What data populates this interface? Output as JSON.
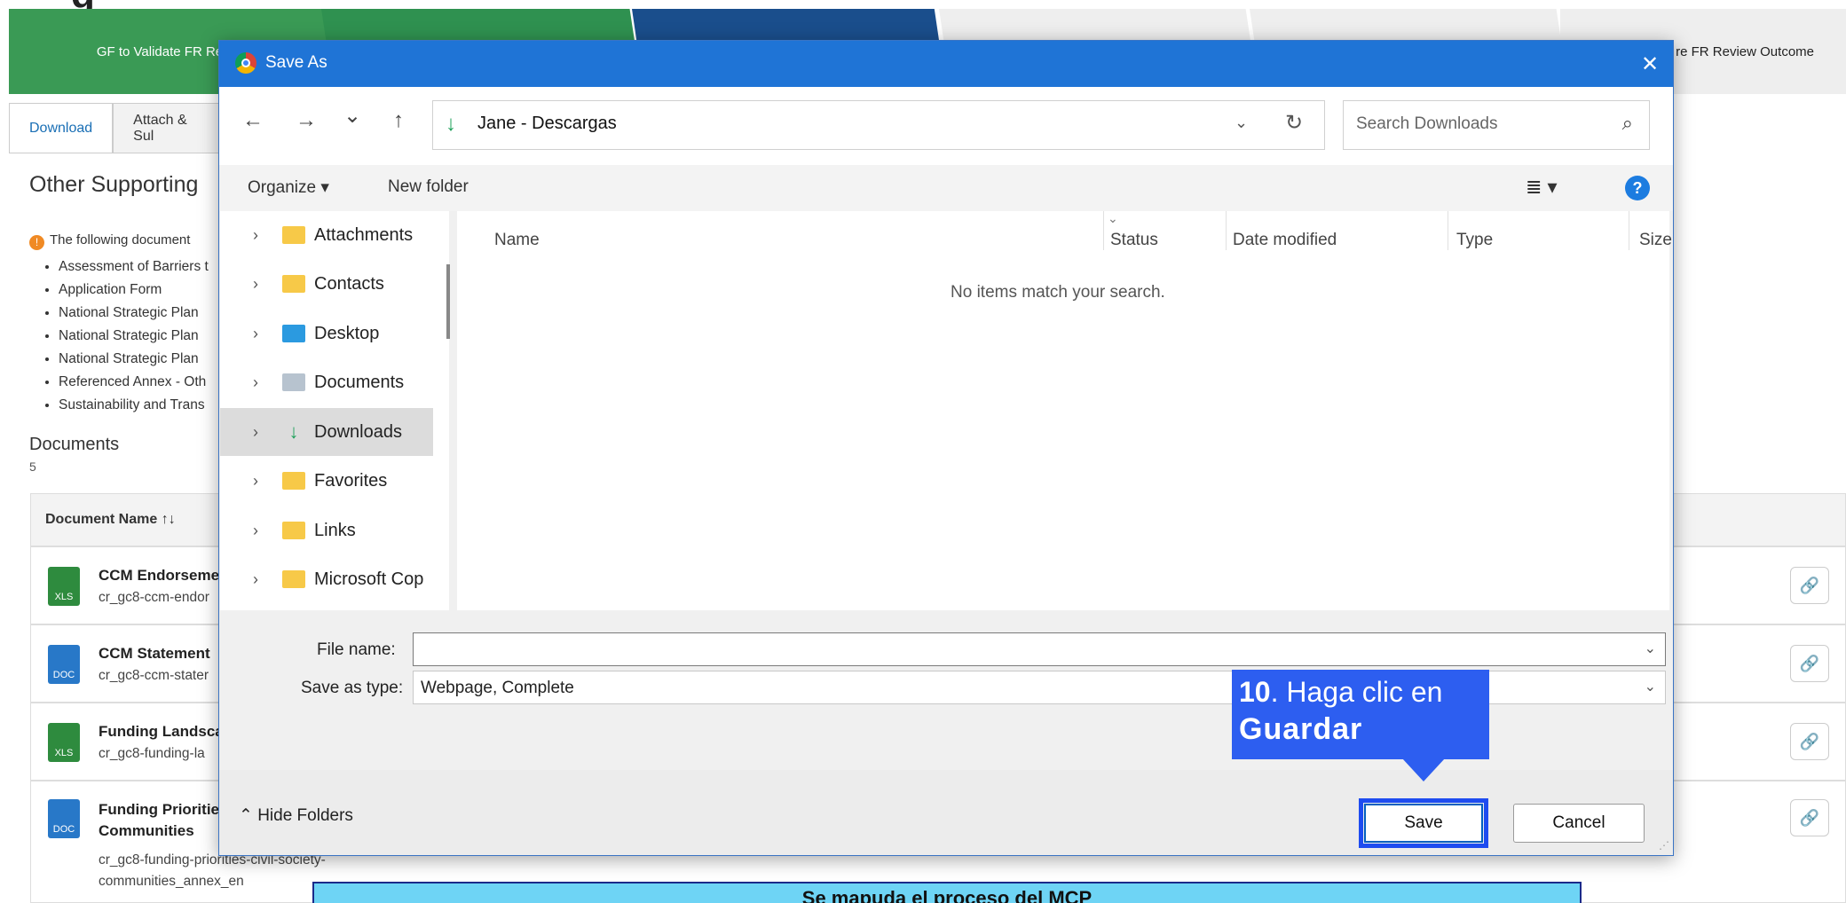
{
  "background": {
    "title_fragment": "g",
    "process_steps": [
      "GF to Validate FR Requi",
      "",
      "",
      "",
      "",
      "re FR Review Outcome"
    ],
    "tabs": [
      "Download",
      "Attach & Sul"
    ],
    "section_title": "Other Supporting",
    "info_text": "The following document",
    "bullets": [
      "Assessment of Barriers t",
      "Application Form",
      "National Strategic Plan",
      "National Strategic Plan",
      "National Strategic Plan",
      "Referenced Annex - Oth",
      "Sustainability and Trans"
    ],
    "documents_title": "Documents",
    "documents_count": "5",
    "table_header": "Document Name ↑↓",
    "rows": [
      {
        "type": "XLS",
        "name": "CCM Endorseme",
        "file": "cr_gc8-ccm-endor"
      },
      {
        "type": "DOC",
        "name": "CCM Statement",
        "file": "cr_gc8-ccm-stater"
      },
      {
        "type": "XLS",
        "name": "Funding Landsca",
        "file": "cr_gc8-funding-la"
      },
      {
        "type": "DOC",
        "name": "Funding Prioritie",
        "name2": "Communities",
        "file": "cr_gc8-funding-priorities-civil-society-",
        "file2": "communities_annex_en"
      }
    ],
    "banner_text": "Se mapuda el proceso del MCP"
  },
  "dialog": {
    "title": "Save As",
    "close_glyph": "✕",
    "nav": {
      "back": "←",
      "forward": "→",
      "recent": "⌄",
      "up": "↑"
    },
    "address_path": "Jane - Descargas",
    "search_placeholder": "Search Downloads",
    "toolbar": {
      "organize": "Organize ▾",
      "new_folder": "New folder",
      "view": "≣ ▾",
      "help": "?"
    },
    "nav_items": [
      {
        "label": "Attachments",
        "icon": "folder-icon"
      },
      {
        "label": "Contacts",
        "icon": "folder-icon"
      },
      {
        "label": "Desktop",
        "icon": "desktop-folder-icon"
      },
      {
        "label": "Documents",
        "icon": "documents-folder-icon"
      },
      {
        "label": "Downloads",
        "icon": "download-arrow-icon",
        "selected": true
      },
      {
        "label": "Favorites",
        "icon": "folder-icon"
      },
      {
        "label": "Links",
        "icon": "folder-icon"
      },
      {
        "label": "Microsoft Cop",
        "icon": "folder-icon"
      }
    ],
    "columns": [
      "Name",
      "Status",
      "Date modified",
      "Type",
      "Size"
    ],
    "empty_message": "No items match your search.",
    "file_name_label": "File name:",
    "file_name_value": "",
    "save_type_label": "Save as type:",
    "save_type_value": "Webpage, Complete",
    "hide_folders": "Hide Folders",
    "save_button": "Save",
    "cancel_button": "Cancel"
  },
  "callout": {
    "number": "10",
    "text": ". Haga clic en",
    "bold": "Guardar"
  },
  "colors": {
    "titlebar": "#1f74d6",
    "callout": "#2d5ef0",
    "green_step": "#3a9a55",
    "blue_step": "#1a4e8c",
    "banner": "#6ed4f5"
  }
}
